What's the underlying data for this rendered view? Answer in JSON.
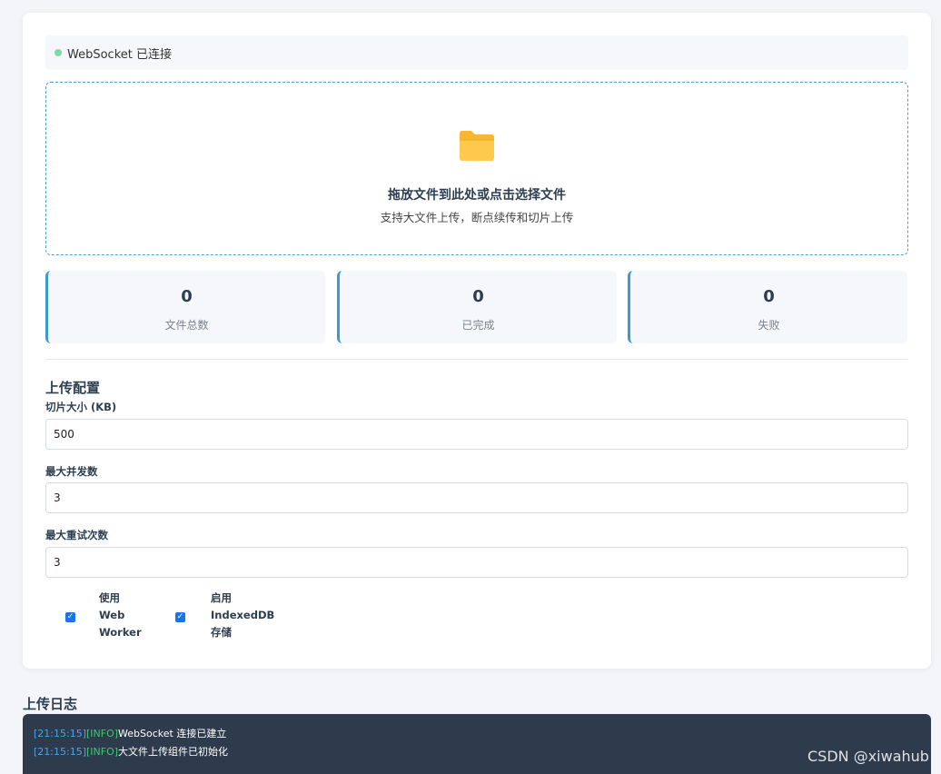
{
  "ws_status": {
    "text": "WebSocket 已连接",
    "dot_color": "#7fd9a4"
  },
  "dropzone": {
    "icon": "folder-icon",
    "title": "拖放文件到此处或点击选择文件",
    "subtitle": "支持大文件上传，断点续传和切片上传"
  },
  "stats": [
    {
      "value": "0",
      "label": "文件总数"
    },
    {
      "value": "0",
      "label": "已完成"
    },
    {
      "value": "0",
      "label": "失败"
    }
  ],
  "config": {
    "title": "上传配置",
    "chunk_size": {
      "label": "切片大小 (KB)",
      "value": "500"
    },
    "max_concurrent": {
      "label": "最大并发数",
      "value": "3"
    },
    "max_retries": {
      "label": "最大重试次数",
      "value": "3"
    },
    "options": [
      {
        "label_lines": [
          "使用",
          "Web",
          "Worker"
        ],
        "checked": true
      },
      {
        "label_lines": [
          "启用",
          "IndexedDB",
          "存储"
        ],
        "checked": true
      }
    ]
  },
  "log": {
    "title": "上传日志",
    "entries": [
      {
        "time": "[21:15:15]",
        "level": "[INFO]",
        "message": "WebSocket 连接已建立"
      },
      {
        "time": "[21:15:15]",
        "level": "[INFO]",
        "message": "大文件上传组件已初始化"
      }
    ]
  },
  "watermark": "CSDN @xiwahub",
  "colors": {
    "accent": "#3a9ad1",
    "checkbox": "#1a73e8",
    "log_bg": "#2d3b4d"
  }
}
